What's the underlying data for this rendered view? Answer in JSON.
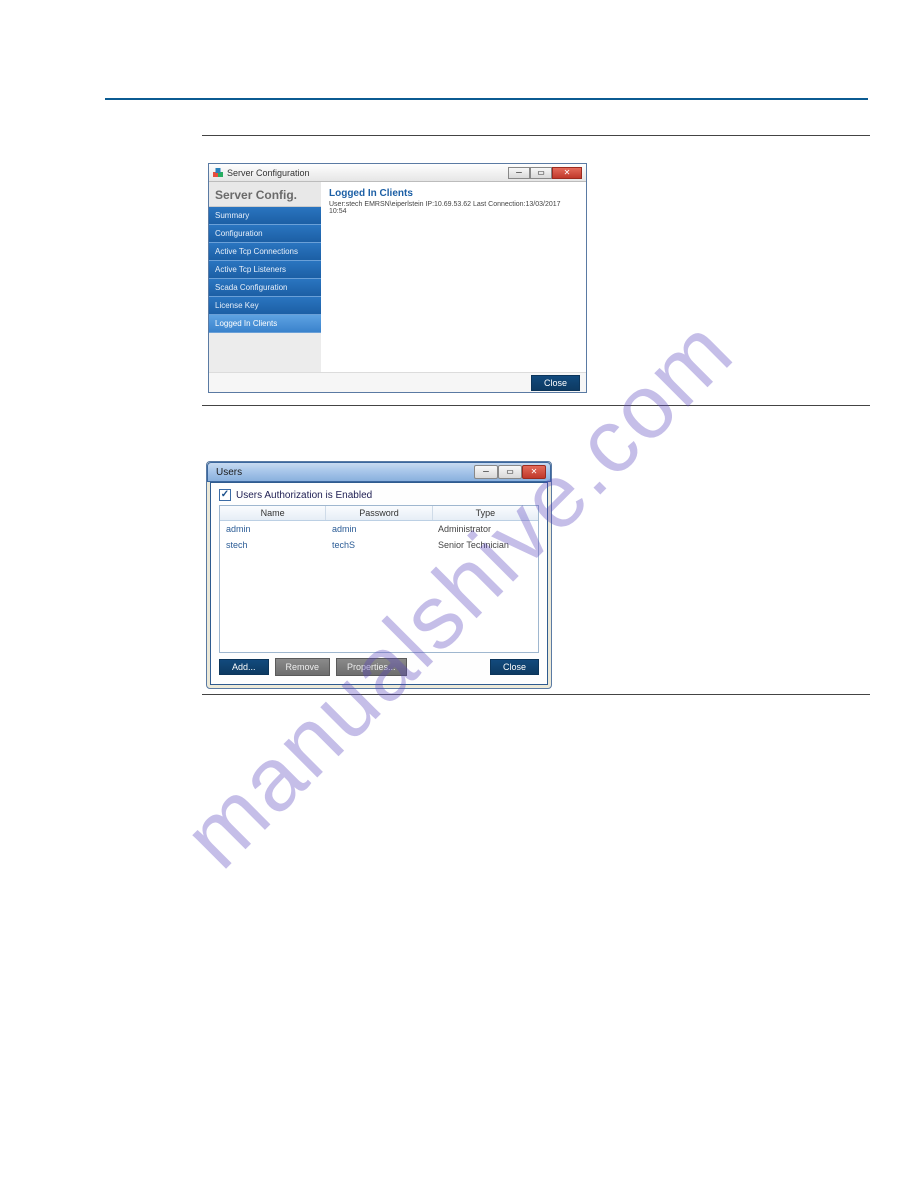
{
  "watermark": "manualshive.com",
  "win1": {
    "title": "Server Configuration",
    "sidebar_title": "Server Config.",
    "sidebar_items": [
      "Summary",
      "Configuration",
      "Active Tcp Connections",
      "Active Tcp Listeners",
      "Scada Configuration",
      "License Key",
      "Logged In Clients"
    ],
    "content_title": "Logged In Clients",
    "content_line": "User:stech EMRSN\\eiperlstein      IP:10.69.53.62   Last Connection:13/03/2017 10:54",
    "close_btn": "Close"
  },
  "win2": {
    "title": "Users",
    "checkbox_label": "Users Authorization is Enabled",
    "checkbox_checked": "✓",
    "columns": [
      "Name",
      "Password",
      "Type"
    ],
    "rows": [
      {
        "name": "admin",
        "password": "admin",
        "type": "Administrator"
      },
      {
        "name": "stech",
        "password": "techS",
        "type": "Senior Technician"
      }
    ],
    "btn_add": "Add...",
    "btn_remove": "Remove",
    "btn_props": "Properties...",
    "btn_close": "Close"
  }
}
